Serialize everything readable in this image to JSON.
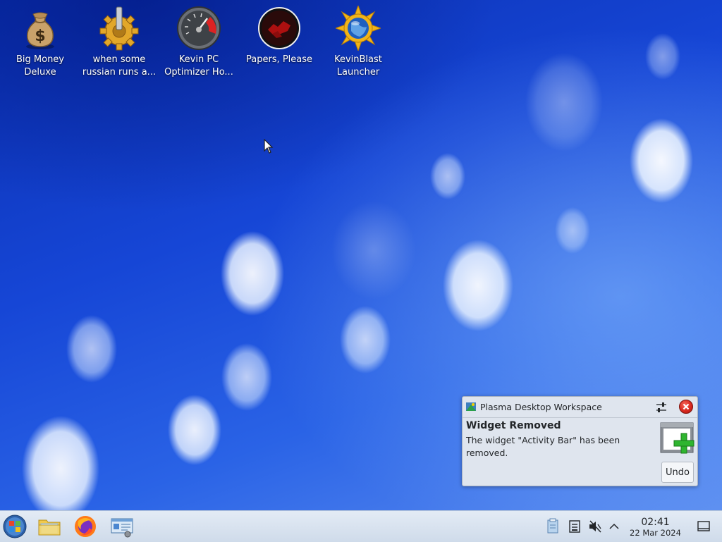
{
  "desktop": {
    "icons": [
      {
        "label": "Big Money Deluxe",
        "icon": "money-bag-icon"
      },
      {
        "label": "when some russian runs a...",
        "icon": "gear-icon"
      },
      {
        "label": "Kevin PC Optimizer Ho...",
        "icon": "speedometer-icon"
      },
      {
        "label": "Papers, Please",
        "icon": "papers-please-emblem-icon"
      },
      {
        "label": "KevinBlast Launcher",
        "icon": "kevinblast-globe-icon"
      }
    ]
  },
  "notification": {
    "app_name": "Plasma Desktop Workspace",
    "title": "Widget Removed",
    "body": "The widget \"Activity Bar\" has been removed.",
    "action_label": "Undo",
    "icons": [
      "plasma-icon",
      "configure-icon",
      "close-icon",
      "widget-add-icon"
    ]
  },
  "taskbar": {
    "launchers": [
      "application-menu-icon",
      "file-manager-icon",
      "firefox-icon",
      "system-settings-icon"
    ],
    "tray": [
      "clipboard-icon",
      "storage-device-icon",
      "volume-muted-icon",
      "expand-tray-icon",
      "show-desktop-icon"
    ],
    "clock": {
      "time": "02:41",
      "date": "22 Mar 2024"
    }
  },
  "colors": {
    "wallpaper": "#1d4fd8",
    "panel": "#d6e0ec",
    "close_button": "#d9281e",
    "plus_green": "#2fb52f"
  }
}
